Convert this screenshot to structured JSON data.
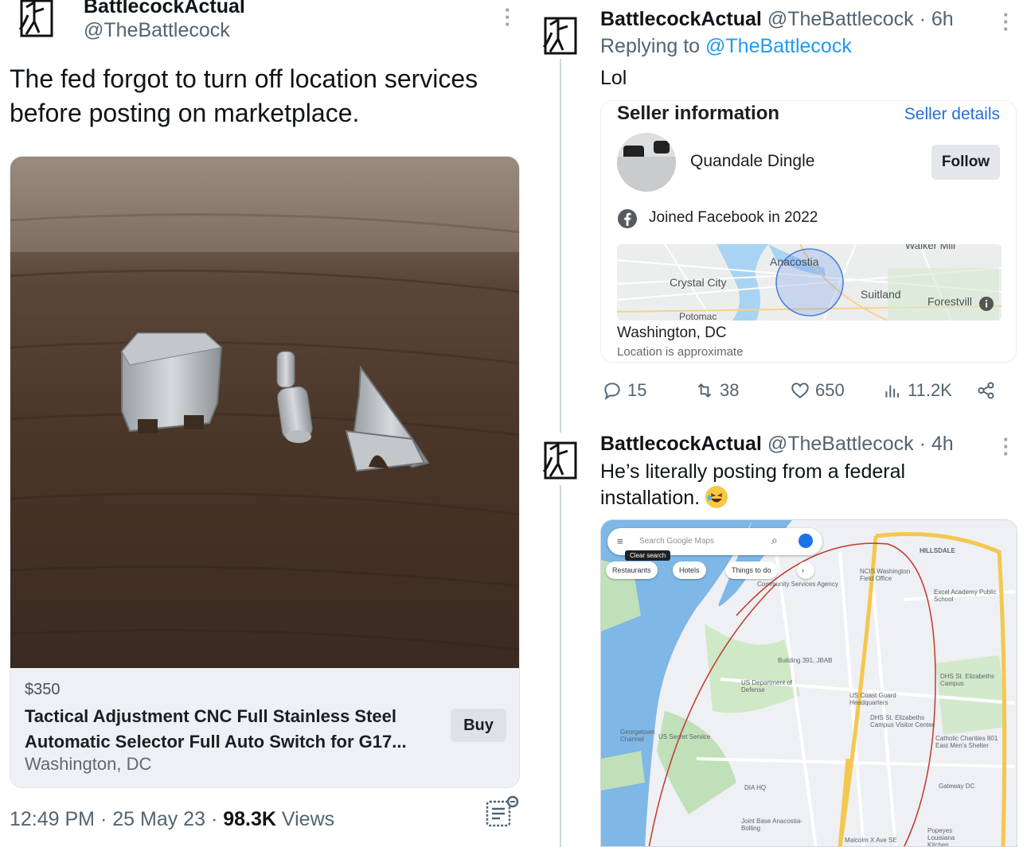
{
  "left_tweet": {
    "name": "BattlecockActual",
    "handle": "@TheBattlecock",
    "text": "The fed forgot to turn off location services before posting on marketplace.",
    "listing": {
      "price": "$350",
      "title": "Tactical Adjustment CNC Full Stainless Steel Automatic Selector Full Auto Switch for G17...",
      "location": "Washington, DC",
      "buy_label": "Buy"
    },
    "time": "12:49 PM",
    "date": "25 May 23",
    "views_count": "98.3K",
    "views_label": "Views",
    "separator": "·"
  },
  "reply_tweet": {
    "name": "BattlecockActual",
    "handle": "@TheBattlecock",
    "age": "6h",
    "replying_prefix": "Replying to",
    "replying_handle": "@TheBattlecock",
    "text": "Lol",
    "seller_card": {
      "heading": "Seller information",
      "details_link": "Seller details",
      "seller_name": "Quandale Dingle",
      "follow_label": "Follow",
      "joined": "Joined Facebook in 2022",
      "map_labels": [
        "Anacostia",
        "Crystal City",
        "Potomac",
        "Suitland",
        "Forestvill",
        "Walker Mill"
      ],
      "city": "Washington, DC",
      "approx_note": "Location is approximate"
    },
    "stats": {
      "replies": "15",
      "retweets": "38",
      "likes": "650",
      "views": "11.2K"
    }
  },
  "third_tweet": {
    "name": "BattlecockActual",
    "handle": "@TheBattlecock",
    "age": "4h",
    "text": "He’s literally posting from a federal installation.",
    "map": {
      "search_placeholder": "Search Google Maps",
      "clear_search": "Clear search",
      "chips": [
        "Restaurants",
        "Hotels",
        "Things to do"
      ],
      "labels": [
        "HILLSDALE",
        "NCIS Washington Field Office",
        "Excel Academy Public School",
        "Community Services Agency",
        "Building 391, JBAB",
        "US Department of Defense",
        "US Coast Guard Headquarters",
        "DHS St. Elizabeths Campus",
        "DHS St. Elizabeths Campus Visitor Center",
        "Catholic Charities 801 East Men's Shelter",
        "US Secret Service",
        "Georgetown Channel",
        "Gateway DC",
        "DIA HQ",
        "Joint Base Anacostia-Bolling",
        "Popeyes Louisiana Kitchen",
        "Malcolm X Ave SE"
      ]
    }
  },
  "colors": {
    "link": "#1d9bf0",
    "fb_link": "#216fdb",
    "muted": "#536471"
  }
}
